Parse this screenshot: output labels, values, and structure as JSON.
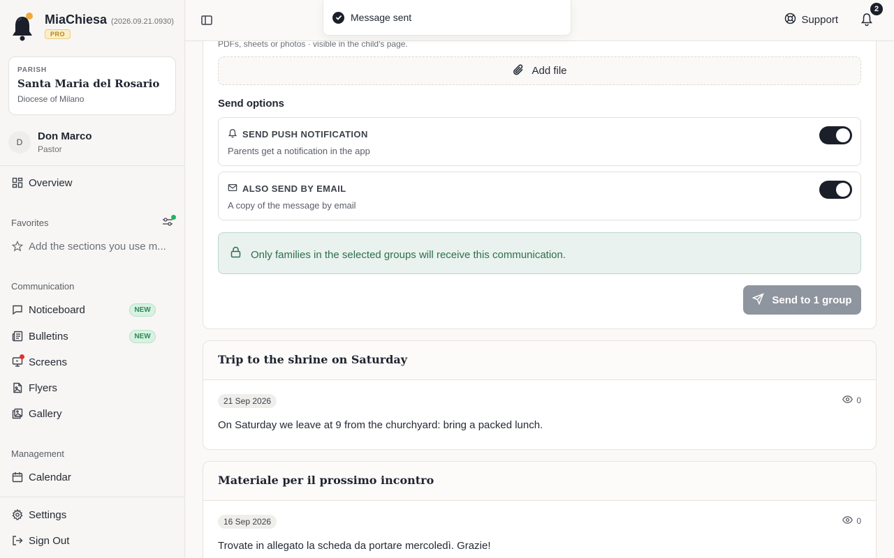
{
  "brand": {
    "name": "MiaChiesa",
    "version": "(2026.09.21.0930)",
    "tier": "PRO"
  },
  "parish": {
    "eyebrow": "PARISH",
    "name": "Santa Maria del Rosario",
    "diocese": "Diocese of Milano"
  },
  "user": {
    "initial": "D",
    "name": "Don Marco",
    "role": "Pastor"
  },
  "nav": {
    "overview": "Overview",
    "favorites_label": "Favorites",
    "favorites_placeholder": "Add the sections you use m...",
    "communication_label": "Communication",
    "communication": [
      {
        "label": "Noticeboard",
        "badge": "NEW"
      },
      {
        "label": "Bulletins",
        "badge": "NEW"
      },
      {
        "label": "Screens"
      },
      {
        "label": "Flyers"
      },
      {
        "label": "Gallery"
      }
    ],
    "management_label": "Management",
    "calendar": "Calendar",
    "settings": "Settings",
    "sign_out": "Sign Out"
  },
  "topbar": {
    "support": "Support",
    "notification_count": "2"
  },
  "toast": {
    "message": "Message sent"
  },
  "composer": {
    "attachments_hint": "PDFs, sheets or photos · visible in the child's page.",
    "add_file": "Add file",
    "send_options_title": "Send options",
    "push": {
      "title": "SEND PUSH NOTIFICATION",
      "desc": "Parents get a notification in the app",
      "enabled": true
    },
    "email": {
      "title": "ALSO SEND BY EMAIL",
      "desc": "A copy of the message by email",
      "enabled": true
    },
    "notice": "Only families in the selected groups will receive this communication.",
    "send_button": "Send to 1 group"
  },
  "posts": [
    {
      "title": "Trip to the shrine on Saturday",
      "date": "21 Sep 2026",
      "views": "0",
      "text": "On Saturday we leave at 9 from the churchyard: bring a packed lunch."
    },
    {
      "title": "Materiale per il prossimo incontro",
      "date": "16 Sep 2026",
      "views": "0",
      "text": "Trovate in allegato la scheda da portare mercoledì. Grazie!"
    }
  ],
  "colors": {
    "accent": "#1b1f2a",
    "success": "#2f6e4e",
    "new_badge": "#2b8a56",
    "alert_dot": "#e03131",
    "pro": "#b58518"
  }
}
